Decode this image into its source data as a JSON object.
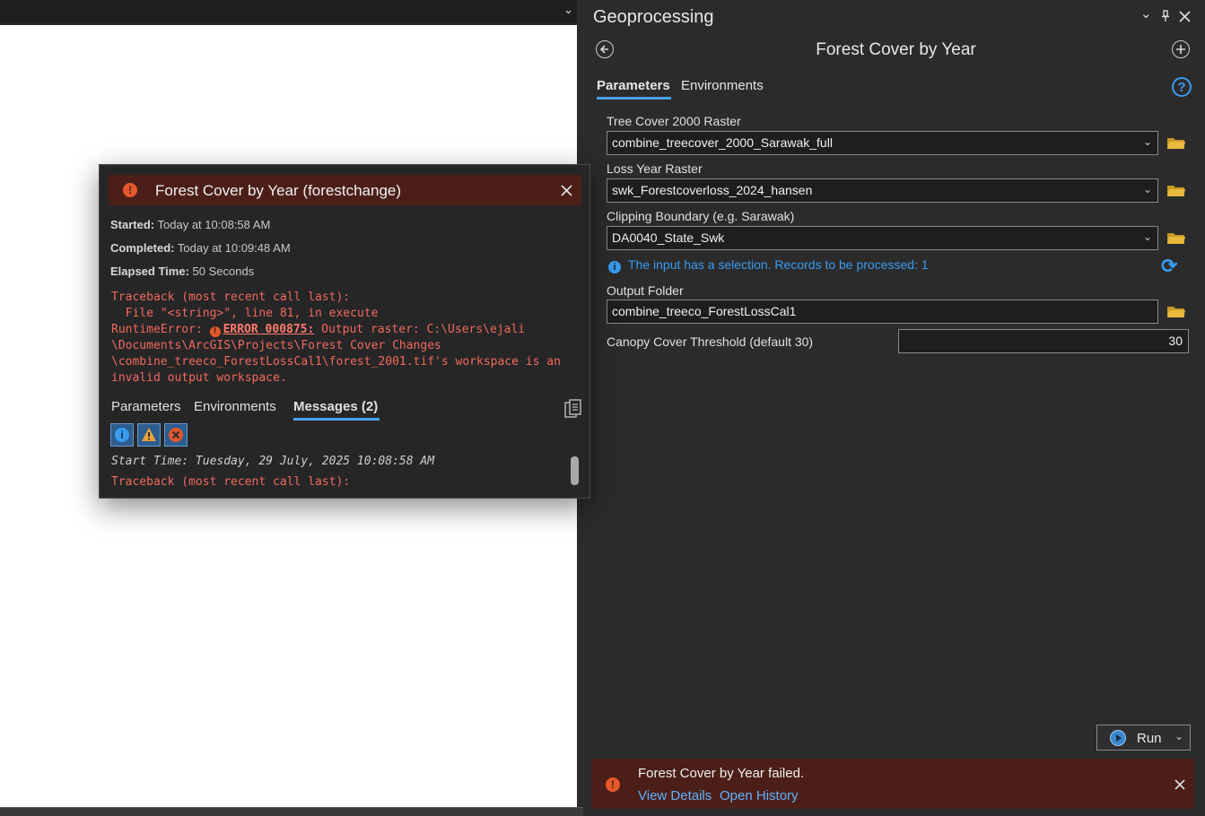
{
  "colors": {
    "accent": "#4aa3ef",
    "error": "#e5582a",
    "error_bg": "#4b1f18",
    "info": "#3a9bf0",
    "folder": "#e8b93c"
  },
  "pane": {
    "title": "Geoprocessing",
    "tool_title": "Forest Cover by Year",
    "tabs": [
      {
        "label": "Parameters",
        "active": true
      },
      {
        "label": "Environments",
        "active": false
      }
    ],
    "help_glyph": "?"
  },
  "params": [
    {
      "label": "Tree Cover 2000 Raster",
      "value": "combine_treecover_2000_Sarawak_full",
      "has_dropdown": true
    },
    {
      "label": "Loss Year Raster",
      "value": "swk_Forestcoverloss_2024_hansen",
      "has_dropdown": true
    },
    {
      "label": "Clipping Boundary (e.g. Sarawak)",
      "value": "DA0040_State_Swk",
      "has_dropdown": true
    },
    {
      "label": "Output Folder",
      "value": "combine_treeco_ForestLossCal1",
      "has_dropdown": false
    }
  ],
  "selection_info": "The input has a selection. Records to be processed: 1",
  "threshold": {
    "label": "Canopy Cover Threshold (default 30)",
    "value": "30"
  },
  "run_label": "Run",
  "failure": {
    "message": "Forest Cover by Year failed.",
    "view_details": "View Details",
    "open_history": "Open History"
  },
  "dialog": {
    "title": "Forest Cover by Year (forestchange)",
    "started_label": "Started:",
    "started_value": "Today at 10:08:58 AM",
    "completed_label": "Completed:",
    "completed_value": "Today at 10:09:48 AM",
    "elapsed_label": "Elapsed Time:",
    "elapsed_value": "50 Seconds",
    "trace_line1": "Traceback (most recent call last):",
    "trace_line2": "  File \"<string>\", line 81, in execute",
    "trace_line3_prefix": "RuntimeError: ",
    "error_code": "ERROR 000875:",
    "trace_line3_rest": " Output raster: C:\\Users\\ejali",
    "trace_line4": "\\Documents\\ArcGIS\\Projects\\Forest Cover Changes",
    "trace_line5": "\\combine_treeco_ForestLossCal1\\forest_2001.tif's workspace is an",
    "trace_line6": "invalid output workspace.",
    "tabs": [
      {
        "label": "Parameters",
        "active": false
      },
      {
        "label": "Environments",
        "active": false
      },
      {
        "label": "Messages (2)",
        "active": true
      }
    ],
    "messages": [
      {
        "text": "Start Time: Tuesday, 29 July, 2025 10:08:58 AM",
        "kind": "info"
      },
      {
        "text": "Traceback (most recent call last):",
        "kind": "error"
      }
    ]
  }
}
